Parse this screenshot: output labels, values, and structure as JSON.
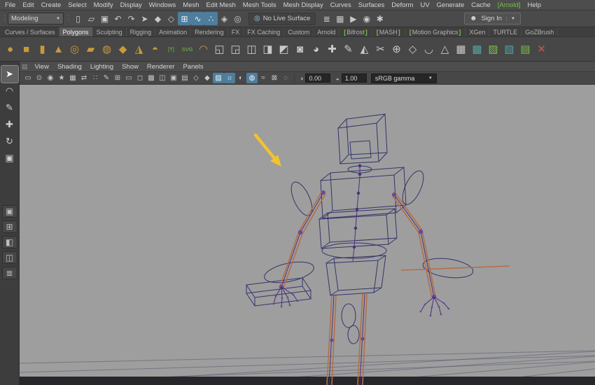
{
  "theme": {
    "gold": "#c99a3a",
    "green": "#77c043",
    "arrow": "#f2c230",
    "wire": "#34346a",
    "limb": "#b46f46",
    "ctrl": "#4a3078",
    "viewport": "#9e9e9e",
    "highlight": "#4f7d9c"
  },
  "menubar": [
    {
      "label": "File"
    },
    {
      "label": "Edit"
    },
    {
      "label": "Create"
    },
    {
      "label": "Select"
    },
    {
      "label": "Modify"
    },
    {
      "label": "Display"
    },
    {
      "label": "Windows"
    },
    {
      "label": "Mesh"
    },
    {
      "label": "Edit Mesh"
    },
    {
      "label": "Mesh Tools"
    },
    {
      "label": "Mesh Display"
    },
    {
      "label": "Curves"
    },
    {
      "label": "Surfaces"
    },
    {
      "label": "Deform"
    },
    {
      "label": "UV"
    },
    {
      "label": "Generate"
    },
    {
      "label": "Cache"
    },
    {
      "label": "[Arnold]",
      "color": "#77c043",
      "name": "menu-item-arnold"
    },
    {
      "label": "Help"
    }
  ],
  "statusbar": {
    "mode": "Modeling",
    "no_live_surface": "No Live Surface",
    "sign_in": "Sign In",
    "icons": [
      {
        "name": "new-scene-icon",
        "glyph": "▯"
      },
      {
        "name": "open-scene-icon",
        "glyph": "▱"
      },
      {
        "name": "save-scene-icon",
        "glyph": "▣"
      },
      {
        "name": "undo-icon",
        "glyph": "↶"
      },
      {
        "name": "redo-icon",
        "glyph": "↷"
      },
      {
        "name": "select-hierarchy-icon",
        "glyph": "➤"
      },
      {
        "name": "select-object-icon",
        "glyph": "◆"
      },
      {
        "name": "select-component-icon",
        "glyph": "◇"
      },
      {
        "name": "snap-grid-icon",
        "glyph": "⊞",
        "active": true
      },
      {
        "name": "snap-curve-icon",
        "glyph": "∿",
        "active": true
      },
      {
        "name": "snap-point-icon",
        "glyph": "∴",
        "active": true
      },
      {
        "name": "snap-plane-icon",
        "glyph": "◈"
      },
      {
        "name": "make-live-icon",
        "glyph": "◎"
      }
    ],
    "icons_right": [
      {
        "name": "construction-history-icon",
        "glyph": "≣"
      },
      {
        "name": "open-render-view-icon",
        "glyph": "▦"
      },
      {
        "name": "render-current-frame-icon",
        "glyph": "▶"
      },
      {
        "name": "ipr-render-icon",
        "glyph": "◉"
      },
      {
        "name": "render-settings-icon",
        "glyph": "✱"
      }
    ]
  },
  "shelf": {
    "tabs": [
      {
        "label": "Curves / Surfaces"
      },
      {
        "label": "Polygons",
        "active": true,
        "name": "shelf-tab-polygons"
      },
      {
        "label": "Sculpting"
      },
      {
        "label": "Rigging"
      },
      {
        "label": "Animation"
      },
      {
        "label": "Rendering"
      },
      {
        "label": "FX"
      },
      {
        "label": "FX Caching"
      },
      {
        "label": "Custom"
      },
      {
        "label": "Arnold"
      },
      {
        "label": "Bifrost",
        "pre": "[",
        "post": "]"
      },
      {
        "label": "MASH",
        "pre": "[",
        "post": "]"
      },
      {
        "label": "Motion Graphics",
        "pre": "[",
        "post": "]"
      },
      {
        "label": "XGen"
      },
      {
        "label": "TURTLE"
      },
      {
        "label": "GoZBrush"
      }
    ],
    "icons": [
      {
        "name": "poly-sphere-icon",
        "glyph": "●",
        "color": "#c99a3a"
      },
      {
        "name": "poly-cube-icon",
        "glyph": "■",
        "color": "#c99a3a"
      },
      {
        "name": "poly-cylinder-icon",
        "glyph": "▮",
        "color": "#c99a3a"
      },
      {
        "name": "poly-cone-icon",
        "glyph": "▲",
        "color": "#c99a3a"
      },
      {
        "name": "poly-torus-icon",
        "glyph": "◎",
        "color": "#c99a3a"
      },
      {
        "name": "poly-plane-icon",
        "glyph": "▰",
        "color": "#c99a3a"
      },
      {
        "name": "poly-disc-icon",
        "glyph": "◍",
        "color": "#c99a3a"
      },
      {
        "name": "poly-platonic-icon",
        "glyph": "◆",
        "color": "#c99a3a"
      },
      {
        "name": "poly-pyramid-icon",
        "glyph": "◮",
        "color": "#c99a3a"
      },
      {
        "name": "poly-super-shape-icon",
        "glyph": "◓",
        "color": "#c99a3a"
      },
      {
        "name": "type-tool-icon",
        "glyph": "[T]",
        "color": "#77c043"
      },
      {
        "name": "svg-tool-icon",
        "glyph": "SVG",
        "color": "#77c043"
      },
      {
        "name": "sweep-mesh-icon",
        "glyph": "◠",
        "color": "#c99a3a"
      },
      {
        "name": "boolean-union-icon",
        "glyph": "◱",
        "color": "#c9c9c9"
      },
      {
        "name": "boolean-difference-icon",
        "glyph": "◲",
        "color": "#c9c9c9"
      },
      {
        "name": "combine-icon",
        "glyph": "◫",
        "color": "#c9c9c9"
      },
      {
        "name": "separate-icon",
        "glyph": "◨",
        "color": "#c9c9c9"
      },
      {
        "name": "extract-icon",
        "glyph": "◩",
        "color": "#c9c9c9"
      },
      {
        "name": "fill-hole-icon",
        "glyph": "◙",
        "color": "#c9c9c9"
      },
      {
        "name": "smooth-icon",
        "glyph": "◕",
        "color": "#c9c9c9"
      },
      {
        "name": "append-polygon-icon",
        "glyph": "✚",
        "color": "#c9c9c9"
      },
      {
        "name": "sculpt-tool-icon",
        "glyph": "✎",
        "color": "#c9c9c9"
      },
      {
        "name": "mirror-icon",
        "glyph": "◭",
        "color": "#c9c9c9"
      },
      {
        "name": "multicut-icon",
        "glyph": "✂",
        "color": "#c9c9c9"
      },
      {
        "name": "target-weld-icon",
        "glyph": "⊕",
        "color": "#c9c9c9"
      },
      {
        "name": "bevel-icon",
        "glyph": "◇",
        "color": "#c9c9c9"
      },
      {
        "name": "bridge-icon",
        "glyph": "◡",
        "color": "#c9c9c9"
      },
      {
        "name": "extrude-icon",
        "glyph": "△",
        "color": "#c9c9c9"
      },
      {
        "name": "quad-draw-icon",
        "glyph": "▦",
        "color": "#c9c9c9"
      },
      {
        "name": "uv-editor-icon",
        "glyph": "▩",
        "color": "#4fa3a3"
      },
      {
        "name": "mash-network-icon",
        "glyph": "▨",
        "color": "#77c043"
      },
      {
        "name": "bifrost-graph-icon",
        "glyph": "▧",
        "color": "#4fa3a3"
      },
      {
        "name": "xgen-description-icon",
        "glyph": "▤",
        "color": "#77c043"
      },
      {
        "name": "delete-history-icon",
        "glyph": "✕",
        "color": "#cc5555"
      }
    ]
  },
  "toolbox": {
    "tools": [
      {
        "name": "select-tool",
        "glyph": "➤",
        "active": true
      },
      {
        "name": "lasso-select-tool",
        "glyph": "◠"
      },
      {
        "name": "paint-select-tool",
        "glyph": "✎"
      },
      {
        "name": "move-tool",
        "glyph": "✚"
      },
      {
        "name": "rotate-tool",
        "glyph": "↻"
      },
      {
        "name": "scale-tool",
        "glyph": "▣"
      }
    ],
    "layouts": [
      {
        "name": "single-pane-layout-button",
        "glyph": "▣"
      },
      {
        "name": "four-pane-layout-button",
        "glyph": "⊞"
      },
      {
        "name": "persp-outliner-layout-button",
        "glyph": "◧"
      },
      {
        "name": "persp-graph-layout-button",
        "glyph": "◫"
      },
      {
        "name": "outliner-toggle-button",
        "glyph": "≣"
      }
    ]
  },
  "panel": {
    "menus": [
      {
        "label": "View"
      },
      {
        "label": "Shading"
      },
      {
        "label": "Lighting"
      },
      {
        "label": "Show"
      },
      {
        "label": "Renderer"
      },
      {
        "label": "Panels"
      }
    ],
    "toolbar": {
      "icons": [
        {
          "name": "view-layout-icon",
          "glyph": "▭"
        },
        {
          "name": "camera-lock-icon",
          "glyph": "⊙"
        },
        {
          "name": "camera-attributes-icon",
          "glyph": "◉"
        },
        {
          "name": "bookmark-icon",
          "glyph": "★"
        },
        {
          "name": "image-plane-icon",
          "glyph": "▦"
        },
        {
          "name": "2d-pan-zoom-icon",
          "glyph": "⇄"
        },
        {
          "name": "oversampling-icon",
          "glyph": "∷"
        },
        {
          "name": "grease-pencil-icon",
          "glyph": "✎"
        },
        {
          "name": "grid-toggle-icon",
          "glyph": "⊞"
        },
        {
          "name": "film-gate-icon",
          "glyph": "▭"
        },
        {
          "name": "resolution-gate-icon",
          "glyph": "◻"
        },
        {
          "name": "gate-mask-icon",
          "glyph": "▩"
        },
        {
          "name": "field-chart-icon",
          "glyph": "◫"
        },
        {
          "name": "safe-action-icon",
          "glyph": "▣"
        },
        {
          "name": "safe-title-icon",
          "glyph": "▤"
        },
        {
          "name": "wireframe-mode-icon",
          "glyph": "◇"
        },
        {
          "name": "shaded-mode-icon",
          "glyph": "◆"
        },
        {
          "name": "textured-mode-icon",
          "glyph": "▨",
          "active": true
        },
        {
          "name": "use-all-lights-icon",
          "glyph": "☼",
          "active": true
        },
        {
          "name": "shadows-icon",
          "glyph": "◐"
        },
        {
          "name": "ambient-occlusion-icon",
          "glyph": "◍",
          "active": true
        },
        {
          "name": "motion-blur-icon",
          "glyph": "≈"
        },
        {
          "name": "xray-icon",
          "glyph": "⊠"
        },
        {
          "name": "isolate-select-icon",
          "glyph": "◌"
        }
      ],
      "exposure": "0.00",
      "gamma": "1.00",
      "view_transform": "sRGB gamma"
    }
  }
}
